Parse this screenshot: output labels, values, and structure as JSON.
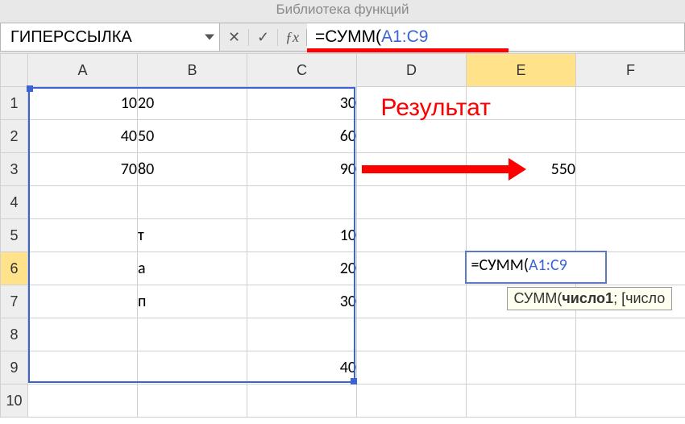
{
  "ribbon": {
    "label": "Библиотека функций"
  },
  "nameBox": {
    "value": "ГИПЕРССЫЛКА"
  },
  "formulaBar": {
    "cancel_glyph": "✕",
    "enter_glyph": "✓",
    "fx_glyph": "ƒx",
    "text_prefix": "=СУММ(",
    "text_ref": "A1:C9"
  },
  "columns": [
    "A",
    "B",
    "C",
    "D",
    "E",
    "F"
  ],
  "rows": [
    "1",
    "2",
    "3",
    "4",
    "5",
    "6",
    "7",
    "8",
    "9",
    "10"
  ],
  "cells": {
    "A1": "10",
    "B1": "20",
    "C1": "30",
    "A2": "40",
    "B2": "50",
    "C2": "60",
    "A3": "70",
    "B3": "80",
    "C3": "90",
    "B5": "т",
    "C5": "10",
    "B6": "а",
    "C6": "20",
    "B7": "п",
    "C7": "30",
    "C9": "40",
    "E3": "550"
  },
  "editing": {
    "prefix": "=СУММ(",
    "ref": "A1:C9"
  },
  "tooltip": {
    "fn": "СУММ",
    "arg1": "число1",
    "arg2_open": "; [число"
  },
  "annotation": {
    "result": "Результат"
  },
  "textCols": [
    "B"
  ]
}
